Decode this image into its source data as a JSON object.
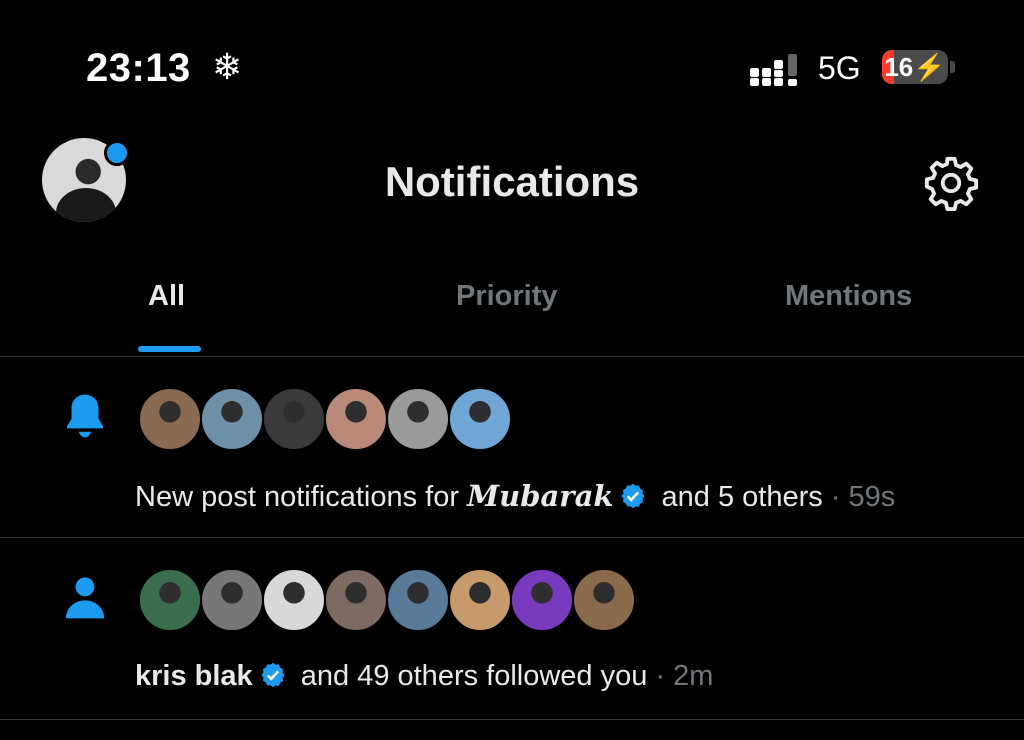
{
  "status_bar": {
    "time": "23:13",
    "snow_glyph": "❄",
    "network": "5G",
    "battery": "16",
    "battery_glyph": "⚡"
  },
  "header": {
    "title": "Notifications",
    "settings_icon": "gear-icon"
  },
  "tabs": [
    {
      "label": "All",
      "active": true
    },
    {
      "label": "Priority",
      "active": false
    },
    {
      "label": "Mentions",
      "active": false
    }
  ],
  "notifications": [
    {
      "icon": "bell-icon",
      "avatar_colors": [
        "#8a6a50",
        "#6d8fa8",
        "#3a3a3a",
        "#b98a7a",
        "#9a9a9a",
        "#6fa6d6"
      ],
      "text_prefix": "New post notifications for ",
      "name": "𝑴𝒖𝒃𝒂𝒓𝒂𝒌",
      "text_suffix": " and 5 others",
      "separator": " · ",
      "time": "59s"
    },
    {
      "icon": "person-icon",
      "avatar_colors": [
        "#3b6e4c",
        "#777777",
        "#d8d8d8",
        "#7d6a60",
        "#5a7a9a",
        "#c69a6a",
        "#7a3ac0",
        "#8a6a4a"
      ],
      "name": "kris blak",
      "text_suffix": " and 49 others followed you",
      "separator": " · ",
      "time": "2m"
    }
  ]
}
